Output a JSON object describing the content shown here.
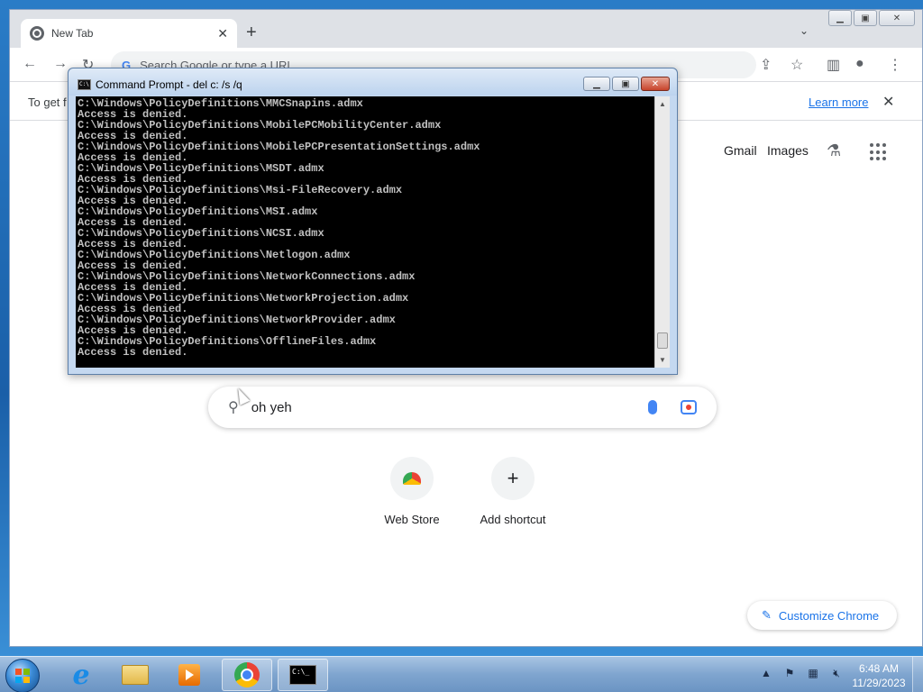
{
  "chrome": {
    "tab_title": "New Tab",
    "new_tab_symbol": "+",
    "tab_search_symbol": "⌄",
    "window_buttons": {
      "minimize": "▁",
      "maximize": "▣",
      "close": "✕"
    },
    "omnibox_placeholder": "Search Google or type a URL",
    "infobar_text": "To get f",
    "infobar_learn_more": "Learn more",
    "top_links": {
      "gmail": "Gmail",
      "images": "Images"
    },
    "search_value": "oh yeh",
    "shortcuts": [
      {
        "label": "Web Store"
      },
      {
        "label": "Add shortcut",
        "symbol": "+"
      }
    ],
    "customize_label": "Customize Chrome"
  },
  "cmd": {
    "title": "Command Prompt - del  c: /s /q",
    "lines": [
      "C:\\Windows\\PolicyDefinitions\\MMCSnapins.admx",
      "Access is denied.",
      "C:\\Windows\\PolicyDefinitions\\MobilePCMobilityCenter.admx",
      "Access is denied.",
      "C:\\Windows\\PolicyDefinitions\\MobilePCPresentationSettings.admx",
      "Access is denied.",
      "C:\\Windows\\PolicyDefinitions\\MSDT.admx",
      "Access is denied.",
      "C:\\Windows\\PolicyDefinitions\\Msi-FileRecovery.admx",
      "Access is denied.",
      "C:\\Windows\\PolicyDefinitions\\MSI.admx",
      "Access is denied.",
      "C:\\Windows\\PolicyDefinitions\\NCSI.admx",
      "Access is denied.",
      "C:\\Windows\\PolicyDefinitions\\Netlogon.admx",
      "Access is denied.",
      "C:\\Windows\\PolicyDefinitions\\NetworkConnections.admx",
      "Access is denied.",
      "C:\\Windows\\PolicyDefinitions\\NetworkProjection.admx",
      "Access is denied.",
      "C:\\Windows\\PolicyDefinitions\\NetworkProvider.admx",
      "Access is denied.",
      "C:\\Windows\\PolicyDefinitions\\OfflineFiles.admx",
      "Access is denied."
    ]
  },
  "taskbar": {
    "time": "6:48 AM",
    "date": "11/29/2023",
    "apps": [
      "internet-explorer",
      "file-explorer",
      "media-player",
      "chrome",
      "command-prompt"
    ]
  }
}
